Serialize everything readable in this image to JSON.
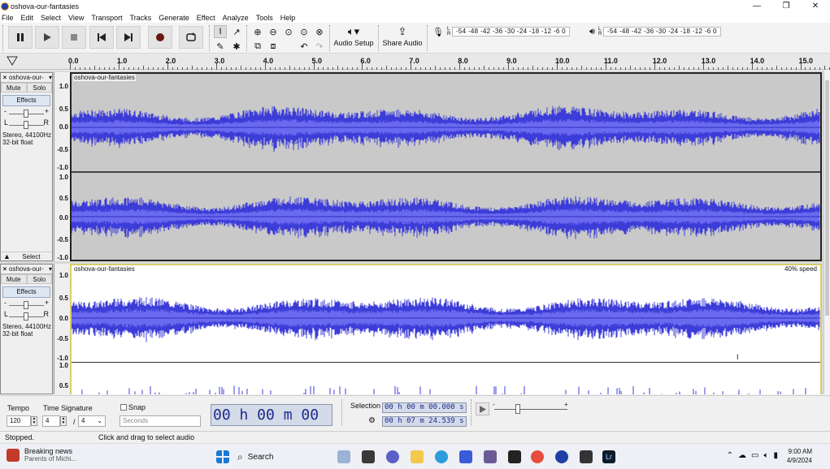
{
  "window": {
    "title": "oshova-our-fantasies",
    "controls": [
      "—",
      "❐",
      "✕"
    ]
  },
  "menu": [
    "File",
    "Edit",
    "Select",
    "View",
    "Transport",
    "Tracks",
    "Generate",
    "Effect",
    "Analyze",
    "Tools",
    "Help"
  ],
  "toolbar": {
    "audio_setup_label": "Audio Setup",
    "share_audio_label": "Share Audio",
    "record_meter": {
      "l": "L",
      "r": "R",
      "scale": "-54 -48 -42 -36 -30 -24 -18 -12 -6 0"
    },
    "playback_meter": {
      "l": "L",
      "r": "R",
      "scale": "-54 -48 -42 -36 -30 -24 -18 -12 -6 0"
    }
  },
  "ruler": {
    "labels": [
      "0.0",
      "1.0",
      "2.0",
      "3.0",
      "4.0",
      "5.0",
      "6.0",
      "7.0",
      "8.0",
      "9.0",
      "10.0",
      "11.0",
      "12.0",
      "13.0",
      "14.0",
      "15.0"
    ]
  },
  "tracks": [
    {
      "name": "oshova-our-",
      "clip_name": "oshova-our-fantasies",
      "mute": "Mute",
      "solo": "Solo",
      "effects": "Effects",
      "gain_minus": "-",
      "gain_plus": "+",
      "pan_l": "L",
      "pan_r": "R",
      "info1": "Stereo, 44100Hz",
      "info2": "32-bit float",
      "select": "Select",
      "axis": [
        "1.0",
        "0.5",
        "0.0",
        "-0.5",
        "-1.0",
        "1.0",
        "0.5",
        "0.0",
        "-0.5",
        "-1.0"
      ],
      "speed": ""
    },
    {
      "name": "oshova-our-",
      "clip_name": "oshova-our-fantasies",
      "mute": "Mute",
      "solo": "Solo",
      "effects": "Effects",
      "gain_minus": "-",
      "gain_plus": "+",
      "pan_l": "L",
      "pan_r": "R",
      "info1": "Stereo, 44100Hz",
      "info2": "32-bit float",
      "axis": [
        "1.0",
        "0.5",
        "0.0",
        "-0.5",
        "-1.0",
        "1.0",
        "0.5"
      ],
      "speed": "40% speed"
    }
  ],
  "bottom_bar": {
    "tempo_label": "Tempo",
    "tempo_value": "120",
    "time_signature_label": "Time Signature",
    "ts_numerator": "4",
    "ts_slash": "/",
    "ts_denominator": "4",
    "snap_label": "Snap",
    "snap_unit": "Seconds",
    "audio_position": "00 h 00 m 00 s",
    "selection_label": "Selection",
    "selection_start": "00 h 00 m 00.000 s",
    "selection_end": "00 h 07 m 24.539 s"
  },
  "status": {
    "state": "Stopped.",
    "hint": "Click and drag to select audio"
  },
  "taskbar": {
    "news_title": "Breaking news",
    "news_sub": "Parents of Michi...",
    "search_label": "Search",
    "time": "9:00 AM",
    "date": "4/9/2024"
  },
  "colors": {
    "waveform": "#3c3cd8",
    "waveform_rms": "#6a6af0",
    "selected_bg": "#c9c9c9",
    "accent": "#d8cd6a"
  }
}
